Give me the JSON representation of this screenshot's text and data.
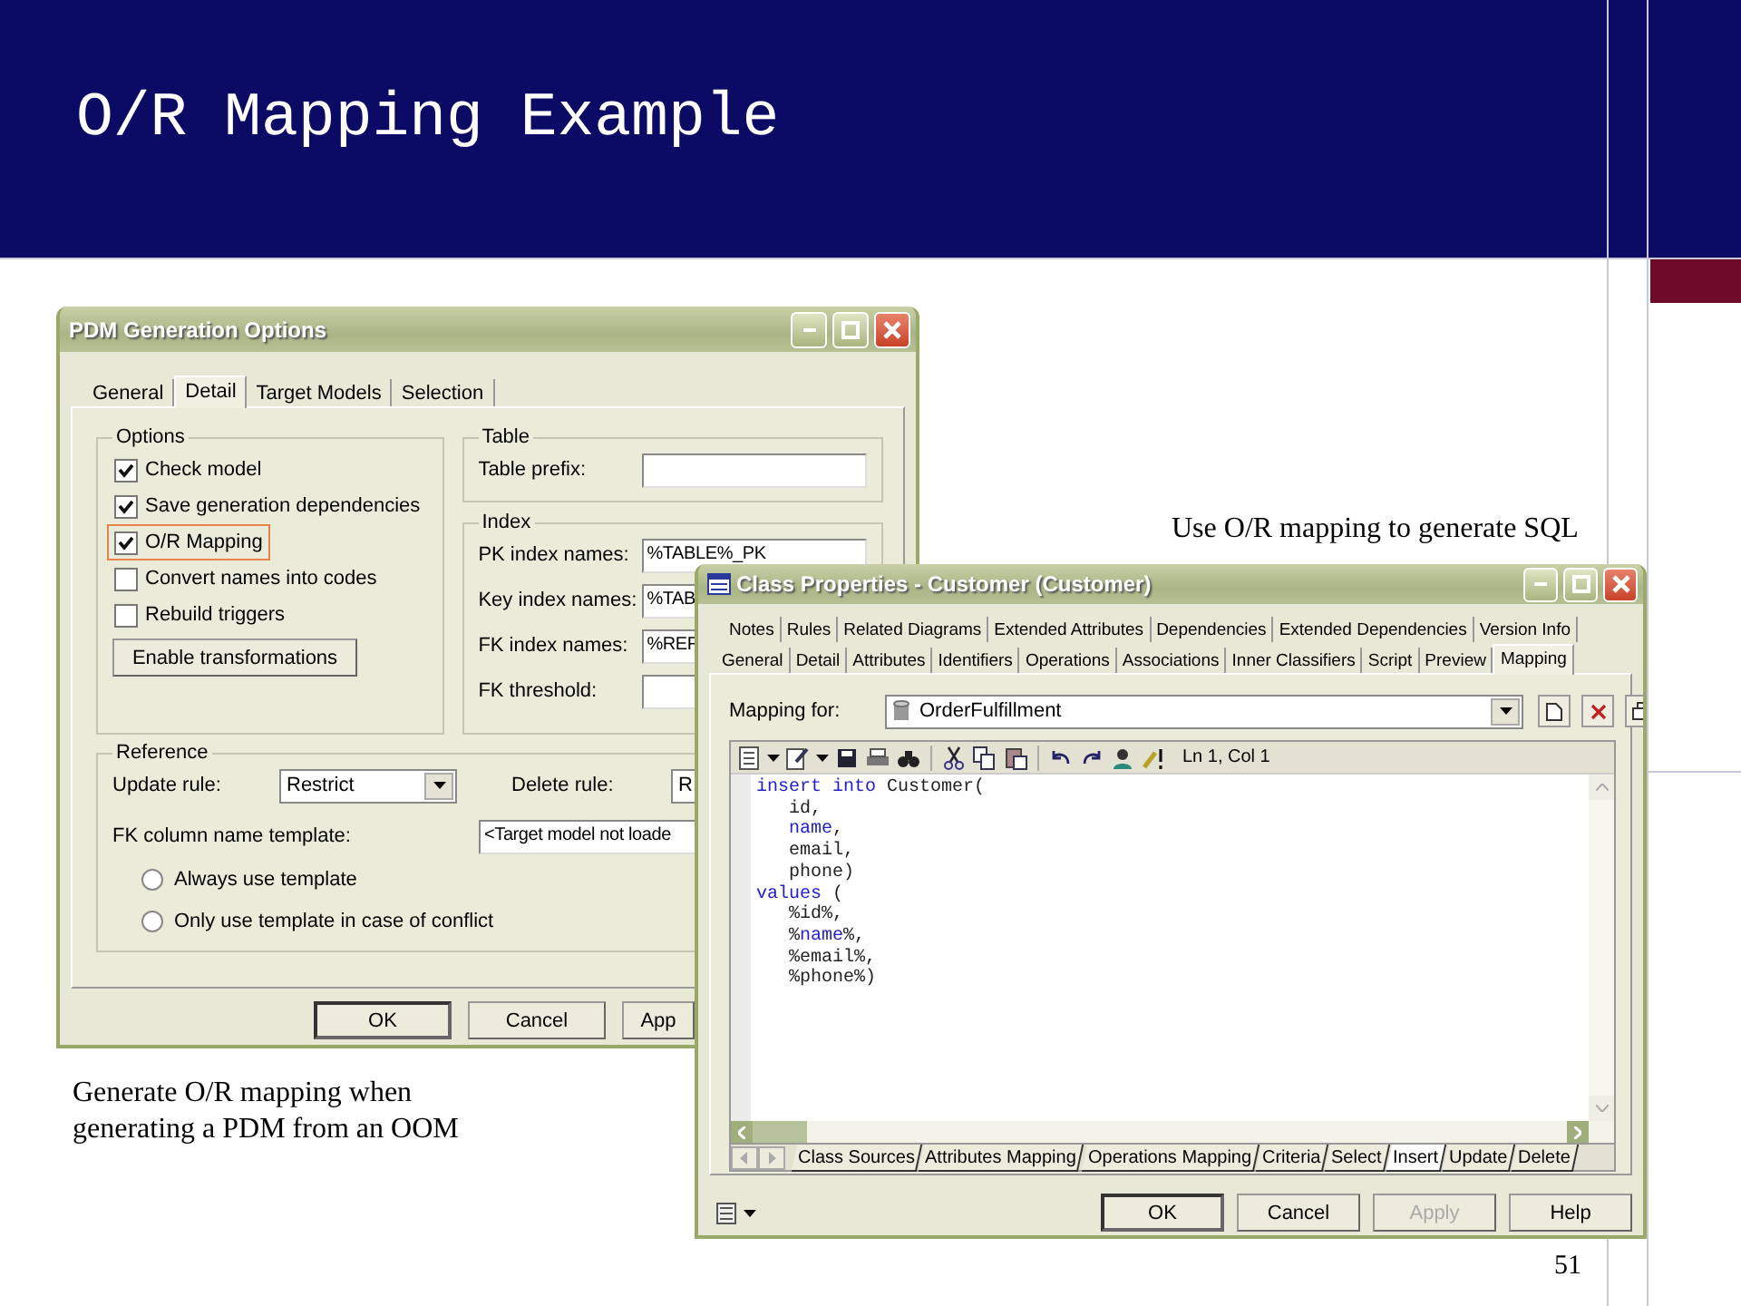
{
  "slide": {
    "title": "O/R Mapping Example",
    "page_number": "51",
    "caption_right": "Use O/R mapping to generate SQL",
    "caption_left": "Generate O/R mapping when generating a PDM from an OOM"
  },
  "pdm_window": {
    "title": "PDM Generation Options",
    "tabs": [
      {
        "label": "General",
        "selected": false
      },
      {
        "label": "Detail",
        "selected": true
      },
      {
        "label": "Target Models",
        "selected": false
      },
      {
        "label": "Selection",
        "selected": false
      }
    ],
    "options": {
      "title": "Options",
      "checkboxes": [
        {
          "label": "Check model",
          "checked": true,
          "highlighted": false
        },
        {
          "label": "Save generation dependencies",
          "checked": true,
          "highlighted": false
        },
        {
          "label": "O/R Mapping",
          "checked": true,
          "highlighted": true
        },
        {
          "label": "Convert names into codes",
          "checked": false,
          "highlighted": false
        },
        {
          "label": "Rebuild triggers",
          "checked": false,
          "highlighted": false
        }
      ],
      "button": "Enable transformations"
    },
    "table": {
      "title": "Table",
      "fields": [
        {
          "label": "Table prefix:"
        }
      ]
    },
    "index": {
      "title": "Index",
      "fields": [
        {
          "label": "PK index names:",
          "value": "%TABLE%_PK"
        },
        {
          "label": "Key index names:",
          "value": "%TAB"
        },
        {
          "label": "FK index names:",
          "value": "%REF"
        },
        {
          "label": "FK threshold:"
        }
      ]
    },
    "reference": {
      "title": "Reference",
      "update_rule": {
        "label": "Update rule:",
        "value": "Restrict"
      },
      "delete_rule": {
        "label": "Delete rule:",
        "value": "R"
      },
      "fk_template": {
        "label": "FK column name template:",
        "value": "<Target model not loade"
      },
      "radios": [
        {
          "label": "Always use template",
          "selected": false
        },
        {
          "label": "Only use template in case of conflict",
          "selected": false
        }
      ]
    },
    "buttons": [
      {
        "label": "OK",
        "default": true
      },
      {
        "label": "Cancel",
        "default": false
      },
      {
        "label": "App",
        "default": false
      }
    ]
  },
  "class_window": {
    "title": "Class Properties - Customer (Customer)",
    "tab_rows": [
      [
        {
          "label": "Notes",
          "selected": false
        },
        {
          "label": "Rules",
          "selected": false
        },
        {
          "label": "Related Diagrams",
          "selected": false
        },
        {
          "label": "Extended Attributes",
          "selected": false
        },
        {
          "label": "Dependencies",
          "selected": false
        },
        {
          "label": "Extended Dependencies",
          "selected": false
        },
        {
          "label": "Version Info",
          "selected": false
        }
      ],
      [
        {
          "label": "General",
          "selected": false
        },
        {
          "label": "Detail",
          "selected": false
        },
        {
          "label": "Attributes",
          "selected": false
        },
        {
          "label": "Identifiers",
          "selected": false
        },
        {
          "label": "Operations",
          "selected": false
        },
        {
          "label": "Associations",
          "selected": false
        },
        {
          "label": "Inner Classifiers",
          "selected": false
        },
        {
          "label": "Script",
          "selected": false
        },
        {
          "label": "Preview",
          "selected": false
        },
        {
          "label": "Mapping",
          "selected": true
        }
      ]
    ],
    "mapping_for": {
      "label": "Mapping for:",
      "value": "OrderFulfillment"
    },
    "cursor_position": "Ln 1, Col 1",
    "code_lines": [
      [
        {
          "text": "insert into",
          "kind": "keyword"
        },
        {
          "text": " Customer(",
          "kind": "plain"
        }
      ],
      [
        {
          "text": "   id,",
          "kind": "plain"
        }
      ],
      [
        {
          "text": "   name",
          "kind": "keyword"
        },
        {
          "text": ",",
          "kind": "plain"
        }
      ],
      [
        {
          "text": "   email,",
          "kind": "plain"
        }
      ],
      [
        {
          "text": "   phone)",
          "kind": "plain"
        }
      ],
      [
        {
          "text": "values",
          "kind": "keyword"
        },
        {
          "text": " (",
          "kind": "plain"
        }
      ],
      [
        {
          "text": "   %id%,",
          "kind": "plain"
        }
      ],
      [
        {
          "text": "   %",
          "kind": "plain"
        },
        {
          "text": "name",
          "kind": "keyword"
        },
        {
          "text": "%,",
          "kind": "plain"
        }
      ],
      [
        {
          "text": "   %email%,",
          "kind": "plain"
        }
      ],
      [
        {
          "text": "   %phone%)",
          "kind": "plain"
        }
      ]
    ],
    "bottom_tabs": [
      {
        "label": "Class Sources",
        "selected": false
      },
      {
        "label": "Attributes Mapping",
        "selected": false
      },
      {
        "label": "Operations Mapping",
        "selected": false
      },
      {
        "label": "Criteria",
        "selected": false
      },
      {
        "label": "Select",
        "selected": false
      },
      {
        "label": "Insert",
        "selected": true
      },
      {
        "label": "Update",
        "selected": false
      },
      {
        "label": "Delete",
        "selected": false
      }
    ],
    "buttons": [
      {
        "label": "OK",
        "default": true,
        "disabled": false
      },
      {
        "label": "Cancel",
        "default": false,
        "disabled": false
      },
      {
        "label": "Apply",
        "default": false,
        "disabled": true
      },
      {
        "label": "Help",
        "default": false,
        "disabled": false
      }
    ]
  }
}
